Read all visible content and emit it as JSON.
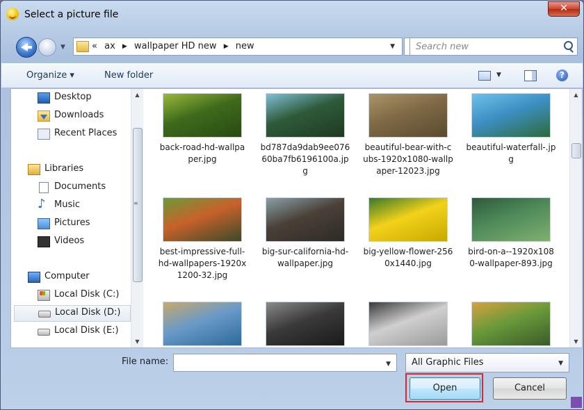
{
  "title": "Select a picture file",
  "address": {
    "parts": [
      "«",
      "ax",
      "wallpaper HD new",
      "new"
    ]
  },
  "search": {
    "placeholder": "Search new"
  },
  "toolbar": {
    "organize": "Organize ▾",
    "new_folder": "New folder"
  },
  "nav": {
    "items": [
      {
        "label": "Desktop",
        "icon": "desktop-icon"
      },
      {
        "label": "Downloads",
        "icon": "downloads-icon"
      },
      {
        "label": "Recent Places",
        "icon": "recent-places-icon"
      },
      {
        "label": "Libraries",
        "icon": "libraries-icon"
      },
      {
        "label": "Documents",
        "icon": "documents-icon"
      },
      {
        "label": "Music",
        "icon": "music-icon"
      },
      {
        "label": "Pictures",
        "icon": "pictures-icon"
      },
      {
        "label": "Videos",
        "icon": "videos-icon"
      },
      {
        "label": "Computer",
        "icon": "computer-icon"
      },
      {
        "label": "Local Disk (C:)",
        "icon": "disk-c-icon"
      },
      {
        "label": "Local Disk (D:)",
        "icon": "disk-icon",
        "selected": true
      },
      {
        "label": "Local Disk (E:)",
        "icon": "disk-icon"
      }
    ]
  },
  "files": [
    {
      "name": "back-road-hd-wallpaper.jpg",
      "colors": [
        "#3f6a1c",
        "#9ab83a",
        "#274b12"
      ]
    },
    {
      "name": "bd787da9dab9ee07660ba7fb6196100a.jpg",
      "colors": [
        "#2f5a3a",
        "#7fc0d6",
        "#1e3a22"
      ]
    },
    {
      "name": "beautiful-bear-with-cubs-1920x1080-wallpaper-12023.jpg",
      "colors": [
        "#7f6a45",
        "#a9946a",
        "#5a4a30"
      ]
    },
    {
      "name": "beautiful-waterfall-.jpg",
      "colors": [
        "#3d8fc4",
        "#6fc1e8",
        "#2e6a3a"
      ]
    },
    {
      "name": "best-impressive-full-hd-wallpapers-1920x1200-32.jpg",
      "colors": [
        "#c8612a",
        "#6d9a3a",
        "#3b4a2a"
      ]
    },
    {
      "name": "big-sur-california-hd-wallpaper.jpg",
      "colors": [
        "#4a4038",
        "#8aa0a8",
        "#2d2a26"
      ]
    },
    {
      "name": "big-yellow-flower-2560x1440.jpg",
      "colors": [
        "#f2d21a",
        "#3a7a2a",
        "#c9a800"
      ]
    },
    {
      "name": "bird-on-a--1920x1080-wallpaper-893.jpg",
      "colors": [
        "#4f8a5a",
        "#2e5a3a",
        "#7fb070"
      ]
    },
    {
      "name": "",
      "colors": [
        "#6a9ac8",
        "#c9a86a",
        "#2d6a9a"
      ]
    },
    {
      "name": "",
      "colors": [
        "#3a3a3a",
        "#8a8a8a",
        "#1a1a1a"
      ]
    },
    {
      "name": "",
      "colors": [
        "#cfcfcf",
        "#3a3a3a",
        "#9a9a9a"
      ]
    },
    {
      "name": "",
      "colors": [
        "#6a9a3a",
        "#d9a040",
        "#3a5a2a"
      ]
    }
  ],
  "filename": {
    "label": "File name:",
    "value": ""
  },
  "filter": {
    "selected": "All Graphic Files"
  },
  "buttons": {
    "open": "Open",
    "cancel": "Cancel"
  }
}
